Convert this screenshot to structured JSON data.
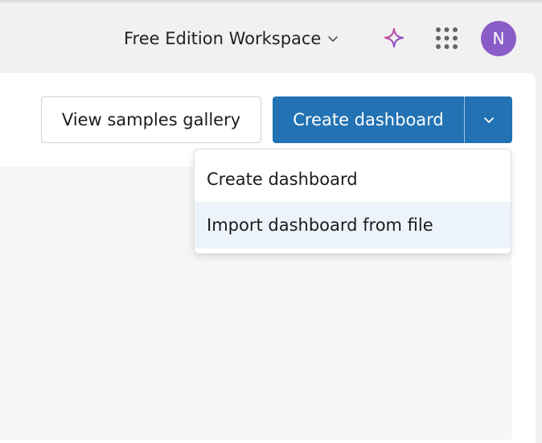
{
  "header": {
    "workspace_label": "Free Edition Workspace",
    "avatar_initial": "N"
  },
  "toolbar": {
    "samples_label": "View samples gallery",
    "create_label": "Create dashboard"
  },
  "menu": {
    "items": [
      {
        "label": "Create dashboard"
      },
      {
        "label": "Import dashboard from file",
        "highlighted": true
      }
    ]
  },
  "icons": {
    "workspace_chevron": "chevron-down-icon",
    "assistant": "sparkle-icon",
    "apps": "apps-grid-icon",
    "create_caret": "chevron-down-icon"
  },
  "colors": {
    "primary": "#2272b4",
    "avatar": "#8a5cc7",
    "menu_highlight": "#edf3fa",
    "sparkle_start": "#e14a86",
    "sparkle_end": "#6e5ce6"
  }
}
